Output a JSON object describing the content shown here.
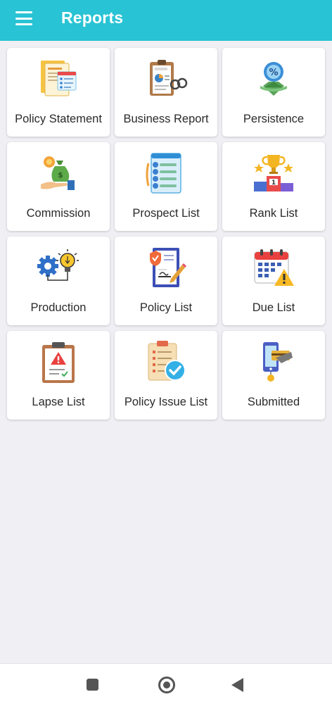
{
  "appbar": {
    "title": "Reports"
  },
  "tiles": [
    {
      "label": "Policy Statement",
      "icon": "document-stack-icon"
    },
    {
      "label": "Business Report",
      "icon": "report-clipboard-icon"
    },
    {
      "label": "Persistence",
      "icon": "percent-badge-icon"
    },
    {
      "label": "Commission",
      "icon": "money-bag-icon"
    },
    {
      "label": "Prospect List",
      "icon": "contact-list-icon"
    },
    {
      "label": "Rank List",
      "icon": "trophy-podium-icon"
    },
    {
      "label": "Production",
      "icon": "gear-bulb-icon"
    },
    {
      "label": "Policy List",
      "icon": "shield-document-icon"
    },
    {
      "label": "Due List",
      "icon": "calendar-warning-icon"
    },
    {
      "label": "Lapse List",
      "icon": "clipboard-warning-icon"
    },
    {
      "label": "Policy Issue List",
      "icon": "checklist-approved-icon"
    },
    {
      "label": "Submitted",
      "icon": "phone-card-icon"
    }
  ],
  "colors": {
    "appbar": "#28c3d4",
    "background": "#f0eff4"
  }
}
